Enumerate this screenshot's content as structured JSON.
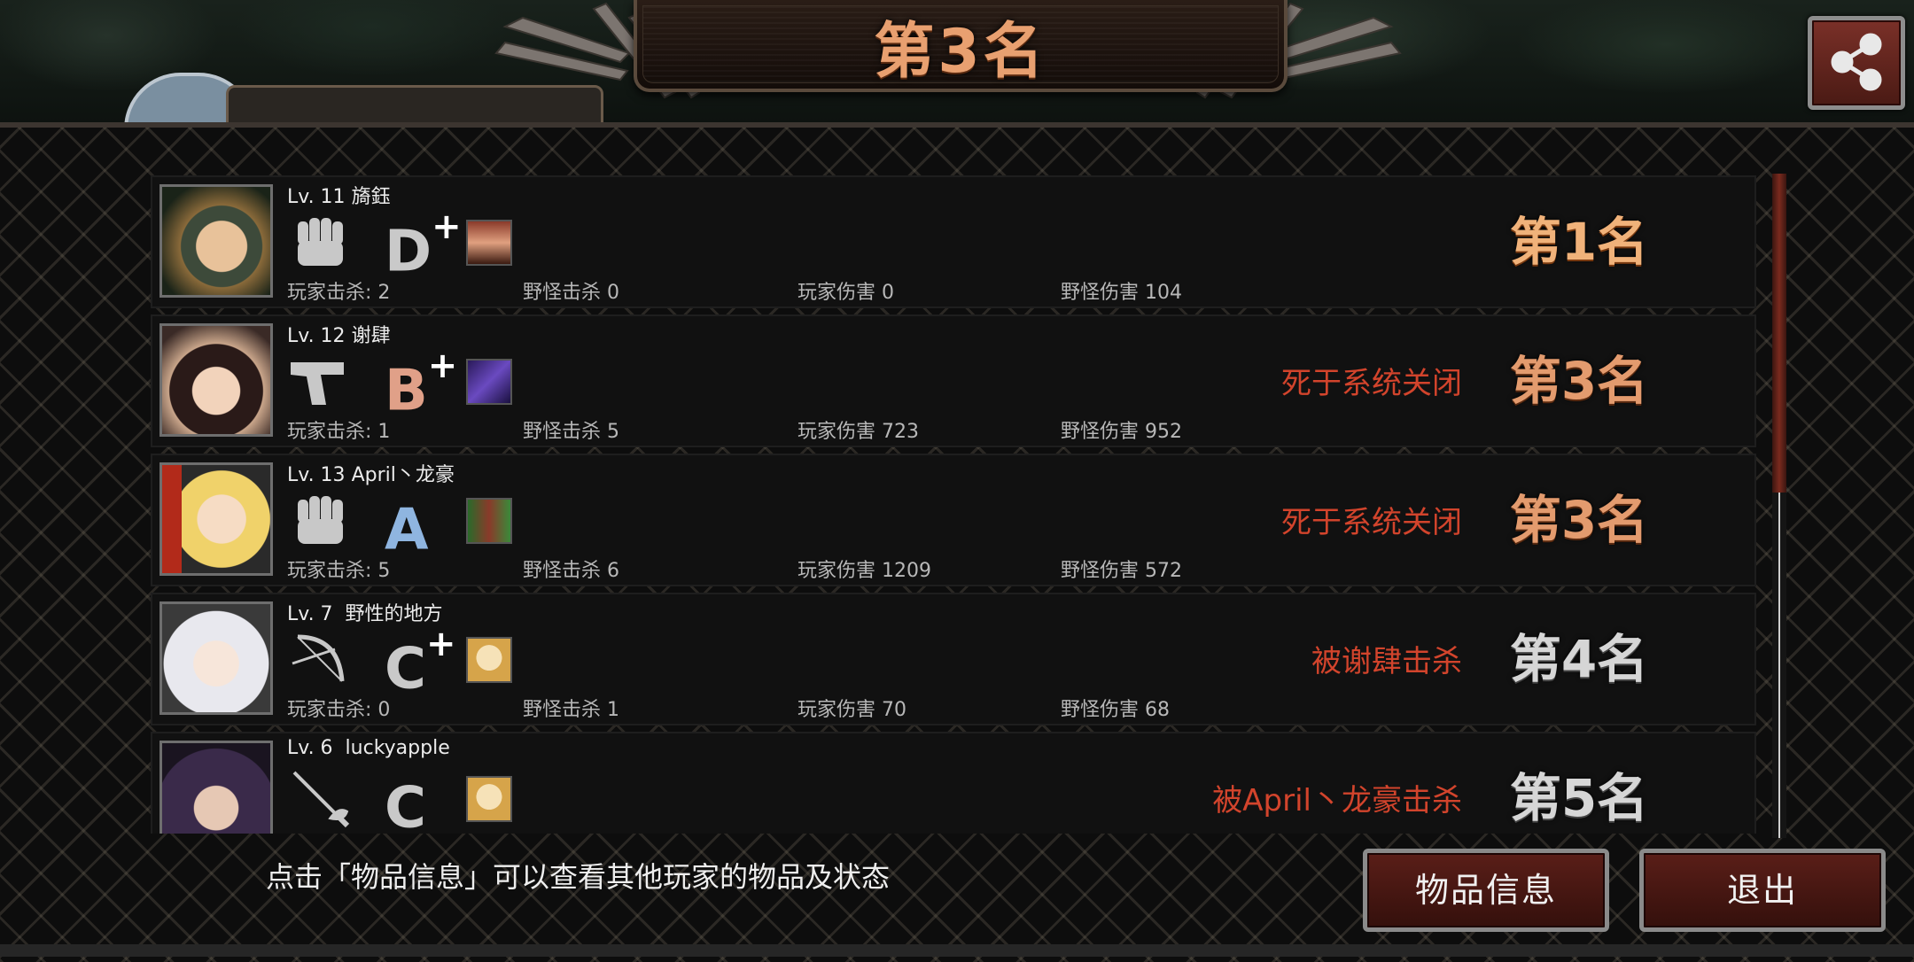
{
  "header": {
    "title": "第3名"
  },
  "players": [
    {
      "level": "Lv. 11",
      "name": "旖鈺",
      "weapon": "fist-icon",
      "grade": "D",
      "grade_plus": "+",
      "grade_color": "#c9c9c9",
      "player_kills": "玩家击杀: 2",
      "monster_kills": "野怪击杀 0",
      "player_damage": "玩家伤害 0",
      "monster_damage": "野怪伤害 104",
      "death": "",
      "rank": "第1名",
      "rank_color": "#f0b27a"
    },
    {
      "level": "Lv. 12",
      "name": "谢肆",
      "weapon": "pistol-icon",
      "grade": "B",
      "grade_plus": "+",
      "grade_color": "#e0a088",
      "player_kills": "玩家击杀: 1",
      "monster_kills": "野怪击杀 5",
      "player_damage": "玩家伤害 723",
      "monster_damage": "野怪伤害 952",
      "death": "死于系统关闭",
      "rank": "第3名",
      "rank_color": "#e39b6e"
    },
    {
      "level": "Lv. 13",
      "name": "April丶龙豪",
      "weapon": "fist-icon",
      "grade": "A",
      "grade_plus": "",
      "grade_color": "#8fb5e0",
      "player_kills": "玩家击杀: 5",
      "monster_kills": "野怪击杀 6",
      "player_damage": "玩家伤害 1209",
      "monster_damage": "野怪伤害 572",
      "death": "死于系统关闭",
      "rank": "第3名",
      "rank_color": "#e39b6e"
    },
    {
      "level": "Lv. 7",
      "name": " 野性的地方",
      "weapon": "bow-icon",
      "grade": "C",
      "grade_plus": "+",
      "grade_color": "#c9c9c9",
      "player_kills": "玩家击杀: 0",
      "monster_kills": "野怪击杀 1",
      "player_damage": "玩家伤害 70",
      "monster_damage": "野怪伤害 68",
      "death": "被谢肆击杀",
      "rank": "第4名",
      "rank_color": "#d6d6d6"
    },
    {
      "level": "Lv. 6",
      "name": " luckyapple",
      "weapon": "rapier-icon",
      "grade": "C",
      "grade_plus": "",
      "grade_color": "#c9c9c9",
      "player_kills": "",
      "monster_kills": "",
      "player_damage": "",
      "monster_damage": "",
      "death": "被April丶龙豪击杀",
      "rank": "第5名",
      "rank_color": "#d6d6d6"
    }
  ],
  "footer": {
    "hint": "点击「物品信息」可以查看其他玩家的物品及状态",
    "info_button": "物品信息",
    "exit_button": "退出"
  },
  "icons": {
    "share": "share-icon"
  },
  "colors": {
    "death_text": "#d2442c",
    "button_bg": "#5a1e18"
  }
}
